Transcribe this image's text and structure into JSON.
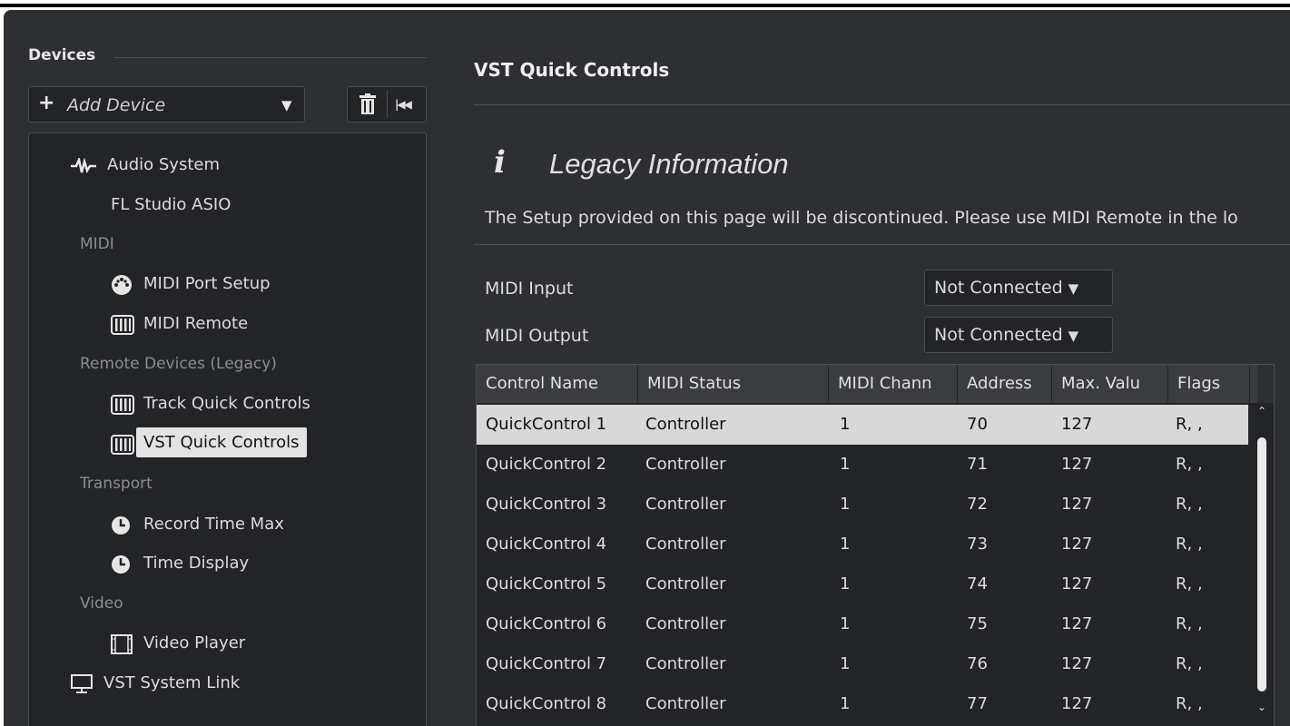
{
  "sidebar": {
    "title": "Devices",
    "add_device_label": "Add Device",
    "tree": [
      {
        "label": "Audio System",
        "icon": "waveform-icon",
        "type": "item"
      },
      {
        "label": "FL Studio ASIO",
        "icon": "",
        "type": "item"
      },
      {
        "label": "MIDI",
        "type": "category"
      },
      {
        "label": "MIDI Port Setup",
        "icon": "midi-port-icon",
        "type": "item"
      },
      {
        "label": "MIDI Remote",
        "icon": "keyboard-icon",
        "type": "item"
      },
      {
        "label": "Remote Devices (Legacy)",
        "type": "category"
      },
      {
        "label": "Track Quick Controls",
        "icon": "keyboard-icon",
        "type": "item"
      },
      {
        "label": "VST Quick Controls",
        "icon": "keyboard-icon",
        "type": "item",
        "selected": true
      },
      {
        "label": "Transport",
        "type": "category"
      },
      {
        "label": "Record Time Max",
        "icon": "clock-icon",
        "type": "item"
      },
      {
        "label": "Time Display",
        "icon": "clock-icon",
        "type": "item"
      },
      {
        "label": "Video",
        "type": "category"
      },
      {
        "label": "Video Player",
        "icon": "film-icon",
        "type": "item"
      },
      {
        "label": "VST System Link",
        "icon": "monitor-icon",
        "type": "item"
      }
    ]
  },
  "main": {
    "title": "VST Quick Controls",
    "legacy_title": "Legacy Information",
    "legacy_text": "The Setup provided on this page will be discontinued. Please use MIDI Remote in the lo",
    "midi_input_label": "MIDI Input",
    "midi_input_value": "Not Connected",
    "midi_output_label": "MIDI Output",
    "midi_output_value": "Not Connected",
    "table": {
      "columns": [
        "Control Name",
        "MIDI Status",
        "MIDI Chann",
        "Address",
        "Max. Valu",
        "Flags"
      ],
      "rows": [
        [
          "QuickControl 1",
          "Controller",
          "1",
          "70",
          "127",
          "R, ,"
        ],
        [
          "QuickControl 2",
          "Controller",
          "1",
          "71",
          "127",
          "R, ,"
        ],
        [
          "QuickControl 3",
          "Controller",
          "1",
          "72",
          "127",
          "R, ,"
        ],
        [
          "QuickControl 4",
          "Controller",
          "1",
          "73",
          "127",
          "R, ,"
        ],
        [
          "QuickControl 5",
          "Controller",
          "1",
          "74",
          "127",
          "R, ,"
        ],
        [
          "QuickControl 6",
          "Controller",
          "1",
          "75",
          "127",
          "R, ,"
        ],
        [
          "QuickControl 7",
          "Controller",
          "1",
          "76",
          "127",
          "R, ,"
        ],
        [
          "QuickControl 8",
          "Controller",
          "1",
          "77",
          "127",
          "R, ,"
        ]
      ],
      "selected_row": 0
    }
  },
  "colors": {
    "background": "#2d2f32",
    "panel": "#232427",
    "selection": "#d8d8d8"
  }
}
